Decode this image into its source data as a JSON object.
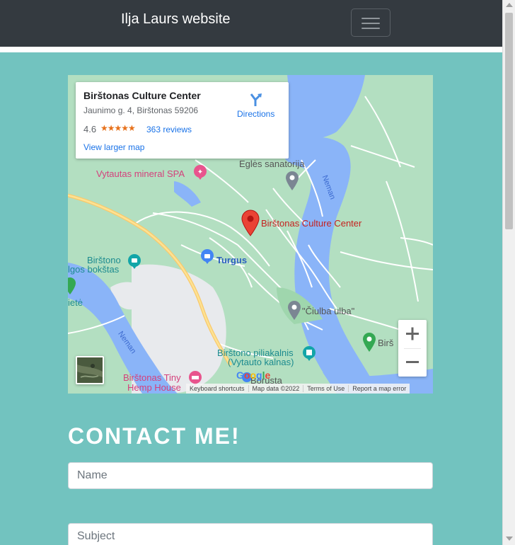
{
  "navbar": {
    "brand": "Ilja Laurs website",
    "toggler_icon": "hamburger-icon"
  },
  "map": {
    "card": {
      "title": "Birštonas Culture Center",
      "address": "Jaunimo g. 4, Birštonas 59206",
      "rating": "4.6",
      "stars": "★★★★★",
      "reviews": "363 reviews",
      "larger_map": "View larger map",
      "directions": "Directions"
    },
    "labels": {
      "vytautas_spa": "Vytautas mineral SPA",
      "egles": "Eglės sanatorija",
      "neman_top": "Neman",
      "culture_center": "Birštonas Culture Center",
      "birstono_line1": "Birštono",
      "birstono_line2": "lgos bokštas",
      "turgus": "Turgus",
      "iete": "ietė",
      "ciulba": "\"Čiulba ulba\"",
      "neman_bottom": "Neman",
      "bir_right": "Birš",
      "piliakalnis_line1": "Birštono piliakalnis",
      "piliakalnis_line2": "(Vytauto kalnas)",
      "tiny_line1": "Birštonas Tiny",
      "tiny_line2": "Hemp House",
      "borusta": "Borusta"
    },
    "google_logo": "Google",
    "attribution": {
      "shortcuts": "Keyboard shortcuts",
      "data": "Map data ©2022",
      "terms": "Terms of Use",
      "report": "Report a map error"
    },
    "zoom_in_icon": "plus-icon",
    "zoom_out_icon": "minus-icon"
  },
  "contact": {
    "title": "CONTACT ME!",
    "name_placeholder": "Name",
    "subject_placeholder": "Subject"
  },
  "colors": {
    "page_bg": "#72c3bf",
    "navbar_bg": "#343a40",
    "map_land": "#b3dfc1",
    "map_water": "#8ab4f8",
    "link_blue": "#1a73e8"
  }
}
